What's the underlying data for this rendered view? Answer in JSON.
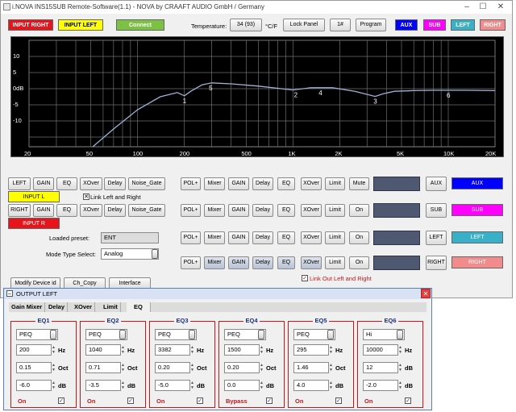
{
  "window": {
    "title": "i.NOVA INS15SUB Remote-Software(1.1) - NOVA by CRAAFT AUDIO GmbH / Germany"
  },
  "top": {
    "input_right": "INPUT RIGHT",
    "input_left": "INPUT LEFT",
    "connect": "Connect",
    "temperature_label": "Temperature:",
    "temperature_value": "34 (93)",
    "temperature_unit": "°C/F",
    "lock_panel": "Lock Panel",
    "preset_number": "1#",
    "program": "Program",
    "aux": "AUX",
    "sub": "SUB",
    "left": "LEFT",
    "right": "RIGHT"
  },
  "colors": {
    "input_right": "#e8141c",
    "input_left": "#ffff00",
    "connect": "#7cc144",
    "aux": "#0000ff",
    "sub": "#ff00ff",
    "left": "#3ab0c8",
    "right": "#f28b8b",
    "curve": "#9db4d8",
    "eq_border": "#c0181d"
  },
  "chart_data": {
    "type": "line",
    "x_scale": "log",
    "x_ticks": [
      "20",
      "50",
      "100",
      "200",
      "500",
      "1K",
      "2K",
      "5K",
      "10K",
      "20K"
    ],
    "x_tick_values": [
      20,
      50,
      100,
      200,
      500,
      1000,
      2000,
      5000,
      10000,
      20000
    ],
    "y_ticks": [
      "10",
      "5",
      "0dB",
      "-5",
      "-10"
    ],
    "y_tick_values": [
      10,
      5,
      0,
      -5,
      -10
    ],
    "ylim": [
      -18,
      15
    ],
    "xlim": [
      20,
      20000
    ],
    "grid": true,
    "series": [
      {
        "x": [
          20,
          30,
          50,
          70,
          100,
          140,
          180,
          200,
          220,
          260,
          300,
          400,
          600,
          1000,
          1300,
          1800,
          2500,
          3382,
          3800,
          4500,
          6000,
          8000,
          10000,
          13000,
          20000
        ],
        "y": [
          -30,
          -26,
          -18.5,
          -12.5,
          -6.5,
          -2.5,
          -1.2,
          -2.2,
          -0.8,
          1.2,
          1.8,
          1.5,
          0.8,
          -0.4,
          0.3,
          0.3,
          -0.8,
          -2.4,
          -1.6,
          -0.8,
          -0.6,
          -0.5,
          -0.5,
          -0.5,
          -0.6
        ]
      }
    ],
    "markers": [
      {
        "label": "1",
        "x": 200,
        "y": -2.2
      },
      {
        "label": "5",
        "x": 295,
        "y": 1.8
      },
      {
        "label": "2",
        "x": 1040,
        "y": -0.4
      },
      {
        "label": "4",
        "x": 1500,
        "y": 0.3
      },
      {
        "label": "3",
        "x": 3382,
        "y": -2.4
      },
      {
        "label": "6",
        "x": 10000,
        "y": -0.5
      }
    ]
  },
  "controls": {
    "left": "LEFT",
    "gain": "GAIN",
    "eq": "EQ",
    "xover": "XOver",
    "delay": "Delay",
    "noise_gate": "Noise_Gate",
    "input_l": "INPUT L",
    "link_left_right": "Link Left and Right",
    "right": "RIGHT",
    "input_r": "INPUT R",
    "loaded_preset_label": "Loaded preset:",
    "loaded_preset_value": "ENT",
    "mode_type_label": "Mode Type Select:",
    "mode_type_value": "Analog",
    "modify_device_id": "Modify Device id",
    "ch_copy": "Ch_Copy",
    "interface": "Interface",
    "pol": "POL+",
    "mixer": "Mixer",
    "limit": "Limit",
    "mute": "Mute",
    "on": "On",
    "out_aux": "AUX",
    "out_sub": "SUB",
    "out_left": "LEFT",
    "out_right": "RIGHT",
    "link_out": "Link Out Left and Right"
  },
  "output_window": {
    "title": "OUTPUT LEFT",
    "tabs": [
      "Gain Mixer",
      "Delay",
      "XOver",
      "Limit",
      "EQ"
    ],
    "active_tab": "EQ",
    "eqs": [
      {
        "title": "EQ1",
        "type": "PEQ",
        "freq": "200",
        "q": "0.15",
        "gain": "-6.0",
        "state": "On"
      },
      {
        "title": "EQ2",
        "type": "PEQ",
        "freq": "1040",
        "q": "0.71",
        "gain": "-3.5",
        "state": "On"
      },
      {
        "title": "EQ3",
        "type": "PEQ",
        "freq": "3382",
        "q": "0.20",
        "gain": "-5.0",
        "state": "On"
      },
      {
        "title": "EQ4",
        "type": "PEQ",
        "freq": "1500",
        "q": "0.20",
        "gain": "0.0",
        "state": "Bypass"
      },
      {
        "title": "EQ5",
        "type": "PEQ",
        "freq": "295",
        "q": "1.46",
        "gain": "4.0",
        "state": "On"
      },
      {
        "title": "EQ6",
        "type": "Hi",
        "freq": "10000",
        "q": "12",
        "gain": "-2.0",
        "state": "On"
      }
    ],
    "units": {
      "hz": "Hz",
      "oct": "Oct",
      "db": "dB"
    }
  }
}
